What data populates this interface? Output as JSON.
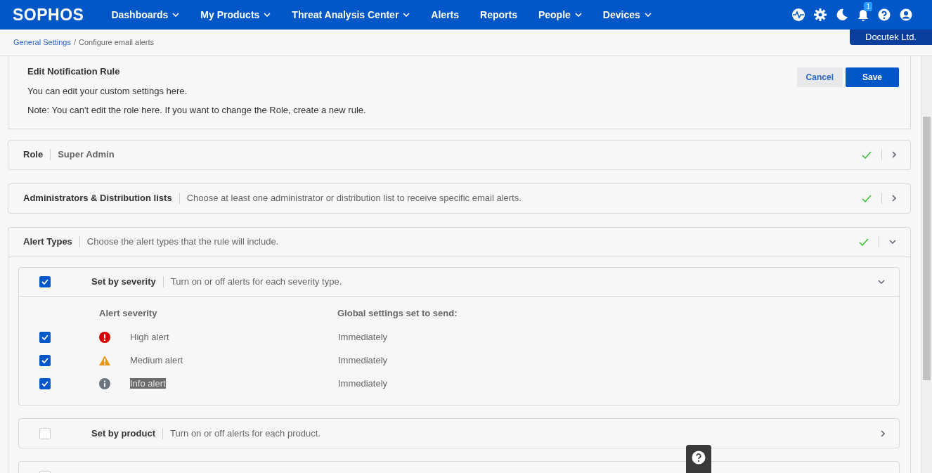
{
  "brand": "SOPHOS",
  "nav": [
    {
      "label": "Dashboards",
      "dropdown": true
    },
    {
      "label": "My Products",
      "dropdown": true
    },
    {
      "label": "Threat Analysis Center",
      "dropdown": true
    },
    {
      "label": "Alerts",
      "dropdown": false
    },
    {
      "label": "Reports",
      "dropdown": false
    },
    {
      "label": "People",
      "dropdown": true
    },
    {
      "label": "Devices",
      "dropdown": true
    }
  ],
  "notification_count": "1",
  "tenant": "Docutek Ltd.",
  "breadcrumb": [
    "General Settings",
    "Configure email alerts"
  ],
  "breadcrumb_separator": "/",
  "header": {
    "title": "Edit Notification Rule",
    "text": "You can edit your custom settings here.",
    "note": "Note: You can't edit the role here. If you want to change the Role, create a new rule.",
    "buttons": [
      "Cancel",
      "Save"
    ]
  },
  "sections": [
    {
      "title": "Role",
      "value": "Super Admin",
      "complete": true,
      "expanded": false
    },
    {
      "title": "Administrators & Distribution lists",
      "description": "Choose at least one administrator or distribution list to receive specific email alerts.",
      "complete": true,
      "expanded": false
    },
    {
      "title": "Alert Types",
      "description": "Choose the alert types that the rule will include.",
      "complete": true,
      "expanded": true
    }
  ],
  "groups": [
    {
      "title": "Set by severity",
      "description": "Turn on or off alerts for each severity type.",
      "checked": true,
      "expanded": true,
      "columns": [
        "Alert severity",
        "Global settings set to send:"
      ],
      "rows": [
        {
          "label": "High alert",
          "kind": "high",
          "checked": true,
          "send": "Immediately",
          "highlighted": false
        },
        {
          "label": "Medium alert",
          "kind": "medium",
          "checked": true,
          "send": "Immediately",
          "highlighted": false
        },
        {
          "label": "Info alert",
          "kind": "info",
          "checked": true,
          "send": "Immediately",
          "highlighted": true
        }
      ]
    },
    {
      "title": "Set by product",
      "description": "Turn on or off alerts for each product.",
      "checked": false,
      "expanded": false
    },
    {
      "checked": false
    }
  ]
}
